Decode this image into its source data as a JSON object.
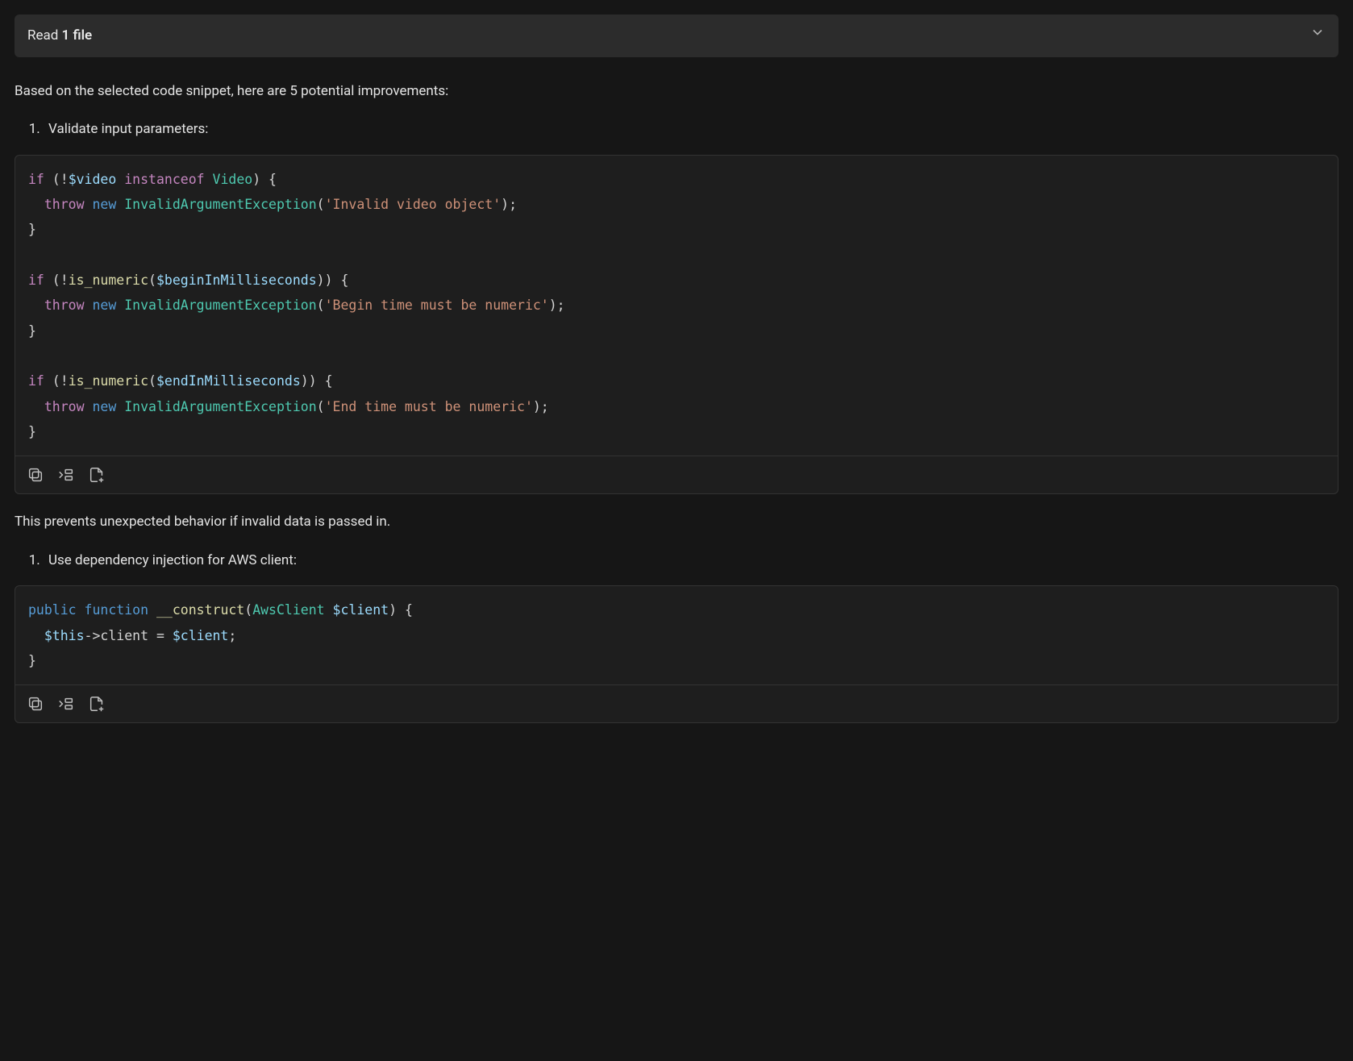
{
  "header": {
    "prefix": "Read ",
    "bold": "1 file"
  },
  "intro": "Based on the selected code snippet, here are 5 potential improvements:",
  "item1_label": "Validate input parameters:",
  "code1": {
    "tokens": [
      [
        [
          "kw",
          "if"
        ],
        [
          "punc",
          " (!"
        ],
        [
          "var",
          "$video"
        ],
        [
          "punc",
          " "
        ],
        [
          "kw",
          "instanceof"
        ],
        [
          "punc",
          " "
        ],
        [
          "type",
          "Video"
        ],
        [
          "punc",
          ") {"
        ]
      ],
      [
        [
          "punc",
          "  "
        ],
        [
          "throw",
          "throw"
        ],
        [
          "punc",
          " "
        ],
        [
          "new",
          "new"
        ],
        [
          "punc",
          " "
        ],
        [
          "type",
          "InvalidArgumentException"
        ],
        [
          "punc",
          "("
        ],
        [
          "str",
          "'Invalid video object'"
        ],
        [
          "punc",
          ");"
        ]
      ],
      [
        [
          "punc",
          "}"
        ]
      ],
      [],
      [
        [
          "kw",
          "if"
        ],
        [
          "punc",
          " (!"
        ],
        [
          "fn",
          "is_numeric"
        ],
        [
          "punc",
          "("
        ],
        [
          "var",
          "$beginInMilliseconds"
        ],
        [
          "punc",
          ")) {"
        ]
      ],
      [
        [
          "punc",
          "  "
        ],
        [
          "throw",
          "throw"
        ],
        [
          "punc",
          " "
        ],
        [
          "new",
          "new"
        ],
        [
          "punc",
          " "
        ],
        [
          "type",
          "InvalidArgumentException"
        ],
        [
          "punc",
          "("
        ],
        [
          "str",
          "'Begin time must be numeric'"
        ],
        [
          "punc",
          ");"
        ]
      ],
      [
        [
          "punc",
          "}"
        ]
      ],
      [],
      [
        [
          "kw",
          "if"
        ],
        [
          "punc",
          " (!"
        ],
        [
          "fn",
          "is_numeric"
        ],
        [
          "punc",
          "("
        ],
        [
          "var",
          "$endInMilliseconds"
        ],
        [
          "punc",
          ")) {"
        ]
      ],
      [
        [
          "punc",
          "  "
        ],
        [
          "throw",
          "throw"
        ],
        [
          "punc",
          " "
        ],
        [
          "new",
          "new"
        ],
        [
          "punc",
          " "
        ],
        [
          "type",
          "InvalidArgumentException"
        ],
        [
          "punc",
          "("
        ],
        [
          "str",
          "'End time must be numeric'"
        ],
        [
          "punc",
          ");"
        ]
      ],
      [
        [
          "punc",
          "}"
        ]
      ]
    ]
  },
  "after1": "This prevents unexpected behavior if invalid data is passed in.",
  "item2_label": "Use dependency injection for AWS client:",
  "code2": {
    "tokens": [
      [
        [
          "new",
          "public"
        ],
        [
          "punc",
          " "
        ],
        [
          "new",
          "function"
        ],
        [
          "punc",
          " "
        ],
        [
          "fn",
          "__construct"
        ],
        [
          "punc",
          "("
        ],
        [
          "type",
          "AwsClient"
        ],
        [
          "punc",
          " "
        ],
        [
          "var",
          "$client"
        ],
        [
          "punc",
          ") {"
        ]
      ],
      [
        [
          "punc",
          "  "
        ],
        [
          "var",
          "$this"
        ],
        [
          "op",
          "->"
        ],
        [
          "punc",
          "client = "
        ],
        [
          "var",
          "$client"
        ],
        [
          "punc",
          ";"
        ]
      ],
      [
        [
          "punc",
          "}"
        ]
      ]
    ]
  }
}
